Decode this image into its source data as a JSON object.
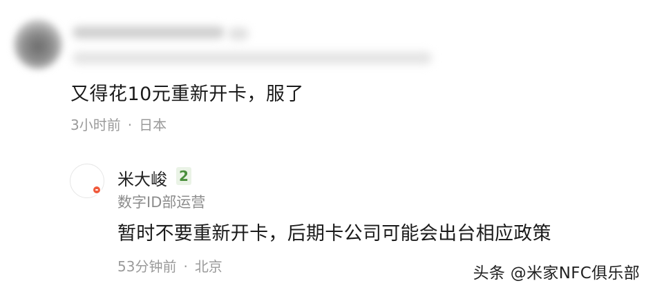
{
  "comment": {
    "text": "又得花10元重新开卡，服了",
    "time": "3小时前",
    "separator": "·",
    "location": "日本"
  },
  "reply": {
    "username": "米大峻",
    "level": "2",
    "role": "数字ID部运营",
    "text": "暂时不要重新开卡，后期卡公司可能会出台相应政策",
    "time": "53分钟前",
    "separator": "·",
    "location": "北京"
  },
  "watermark": "头条 @米家NFC俱乐部"
}
